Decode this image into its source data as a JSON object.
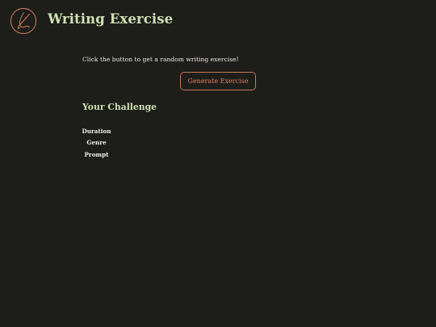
{
  "header": {
    "title": "Writing Exercise",
    "logo_icon": "pen-nib-circle-icon",
    "logo_color": "#c4795a"
  },
  "main": {
    "instructions": "Click the button to get a random writing exercise!",
    "generate_button_label": "Generate Exercise",
    "challenge_heading": "Your Challenge",
    "details": [
      {
        "label": "Duration",
        "value": ""
      },
      {
        "label": "Genre",
        "value": ""
      },
      {
        "label": "Prompt",
        "value": ""
      }
    ]
  },
  "colors": {
    "background": "#1d1d1a",
    "heading": "#cfe0b4",
    "accent": "#e0835f",
    "text": "#ece9e2"
  }
}
